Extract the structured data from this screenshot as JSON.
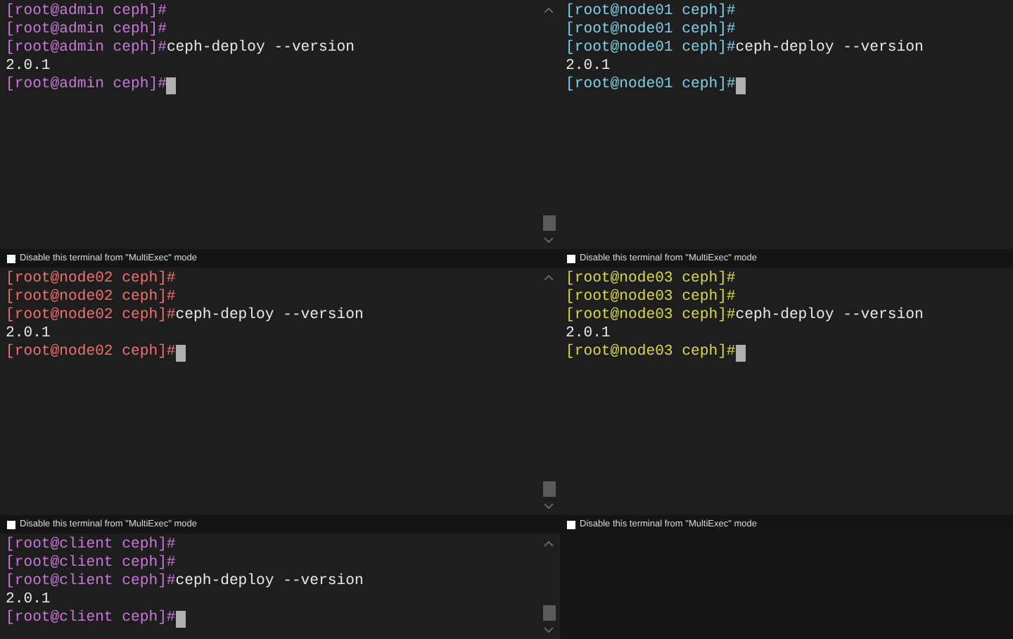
{
  "panes": [
    {
      "kind": "terminal",
      "color": "#c878d8",
      "lines": [
        {
          "prompt": "[root@admin ceph]#"
        },
        {
          "prompt": "[root@admin ceph]#"
        },
        {
          "prompt": "[root@admin ceph]#",
          "command": "ceph-deploy --version"
        },
        {
          "output": "2.0.1"
        },
        {
          "prompt": "[root@admin ceph]#",
          "cursor": true
        }
      ],
      "option": {
        "label": "Disable this terminal from \"MultiExec\" mode",
        "checked": false
      }
    },
    {
      "kind": "terminal",
      "color": "#7fd0e8",
      "lines": [
        {
          "prompt": "[root@node01 ceph]#"
        },
        {
          "prompt": "[root@node01 ceph]#"
        },
        {
          "prompt": "[root@node01 ceph]#",
          "command": "ceph-deploy --version"
        },
        {
          "output": "2.0.1"
        },
        {
          "prompt": "[root@node01 ceph]#",
          "cursor": true
        }
      ],
      "option": {
        "label": "Disable this terminal from \"MultiExec\" mode",
        "checked": false
      }
    },
    {
      "kind": "terminal",
      "color": "#f07070",
      "lines": [
        {
          "prompt": "[root@node02 ceph]#"
        },
        {
          "prompt": "[root@node02 ceph]#"
        },
        {
          "prompt": "[root@node02 ceph]#",
          "command": "ceph-deploy --version"
        },
        {
          "output": "2.0.1"
        },
        {
          "prompt": "[root@node02 ceph]#",
          "cursor": true
        }
      ],
      "option": {
        "label": "Disable this terminal from \"MultiExec\" mode",
        "checked": false
      }
    },
    {
      "kind": "terminal",
      "color": "#d8d848",
      "lines": [
        {
          "prompt": "[root@node03 ceph]#"
        },
        {
          "prompt": "[root@node03 ceph]#"
        },
        {
          "prompt": "[root@node03 ceph]#",
          "command": "ceph-deploy --version"
        },
        {
          "output": "2.0.1"
        },
        {
          "prompt": "[root@node03 ceph]#",
          "cursor": true
        }
      ],
      "option": {
        "label": "Disable this terminal from \"MultiExec\" mode",
        "checked": false
      }
    },
    {
      "kind": "terminal",
      "color": "#c878d8",
      "lines": [
        {
          "prompt": "[root@client ceph]#"
        },
        {
          "prompt": "[root@client ceph]#"
        },
        {
          "prompt": "[root@client ceph]#",
          "command": "ceph-deploy --version"
        },
        {
          "output": "2.0.1"
        },
        {
          "prompt": "[root@client ceph]#",
          "cursor": true
        }
      ]
    },
    {
      "kind": "blank"
    }
  ]
}
